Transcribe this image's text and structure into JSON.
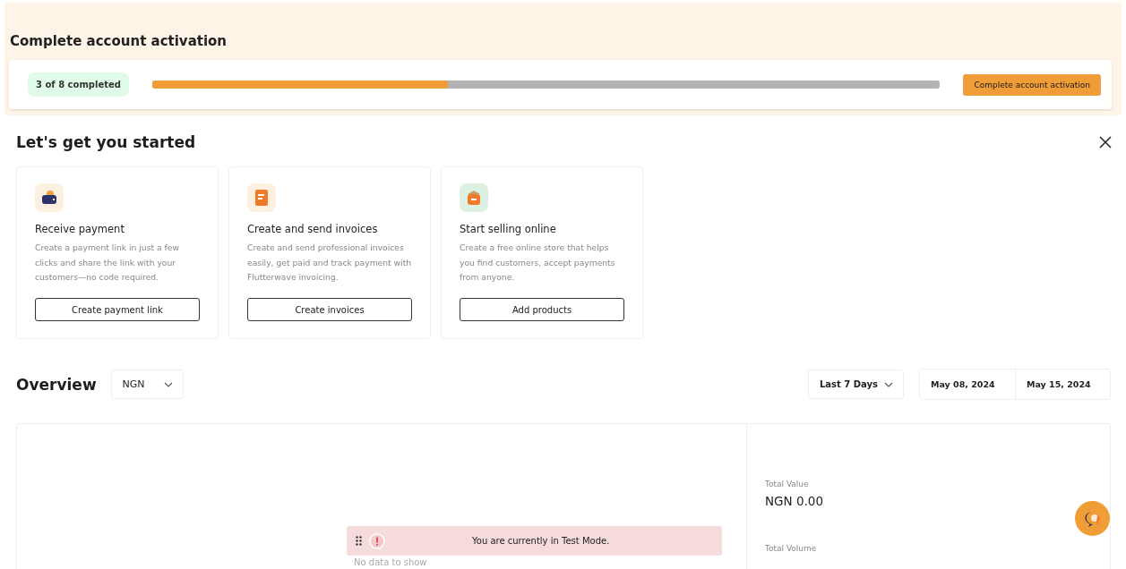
{
  "activation": {
    "title": "Complete account activation",
    "progress_label": "3 of 8 completed",
    "level": 0.375,
    "button": "Complete account activation"
  },
  "getting_started": {
    "title": "Let's get you started",
    "cards": [
      {
        "kind": "wallet",
        "title": "Receive payment",
        "description": "Create a payment link in just a few clicks and share the link with your customers—no code required.",
        "button": "Create payment link"
      },
      {
        "kind": "invoice",
        "title": "Create and send invoices",
        "description": "Create and send professional invoices easily, get paid and track payment with Flutterwave invoicing.",
        "button": "Create invoices"
      },
      {
        "kind": "store",
        "title": "Start selling online",
        "description": "Create a free online store that helps you find customers, accept payments from anyone.",
        "button": "Add products"
      }
    ]
  },
  "overview": {
    "title": "Overview",
    "currency": "NGN",
    "period": "Last 7 Days",
    "start_date": "May 08, 2024",
    "end_date": "May 15, 2024",
    "empty_text": "No data to show",
    "stats": [
      {
        "label": "Total Value",
        "value": "NGN 0.00"
      },
      {
        "label": "Total Volume"
      }
    ]
  },
  "toast": {
    "message": "You are currently in Test Mode."
  }
}
